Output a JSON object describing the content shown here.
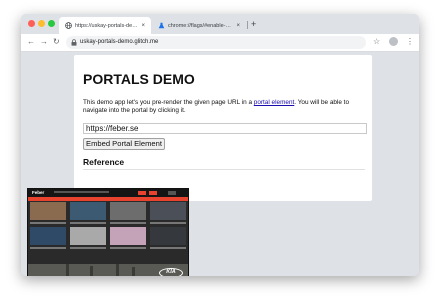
{
  "browser": {
    "tabs": [
      {
        "title": "https://uskay-portals-demo.glitch.me",
        "active": true
      },
      {
        "title": "chrome://flags/#enable-portals",
        "active": false
      }
    ],
    "new_tab": "+",
    "close_glyph": "×",
    "nav": {
      "back": "←",
      "forward": "→",
      "reload": "↻"
    },
    "address": "uskay-portals-demo.glitch.me",
    "bookmark_glyph": "☆",
    "menu_glyph": "⋮"
  },
  "page": {
    "heading": "PORTALS DEMO",
    "intro_before_link": "This demo app let's you pre-render the given page URL in a ",
    "intro_link": "portal element",
    "intro_after_link": ". You will be able to navigate into the portal by clicking it.",
    "url_value": "https://feber.se",
    "embed_button": "Embed Portal Element",
    "reference_heading": "Reference"
  },
  "portal_preview": {
    "site_logo": "Feber",
    "ad_brand": "KIA"
  },
  "colors": {
    "tab_strip": "#dee1e6",
    "link": "#1a0dab",
    "portal_accent": "#e8432f"
  }
}
